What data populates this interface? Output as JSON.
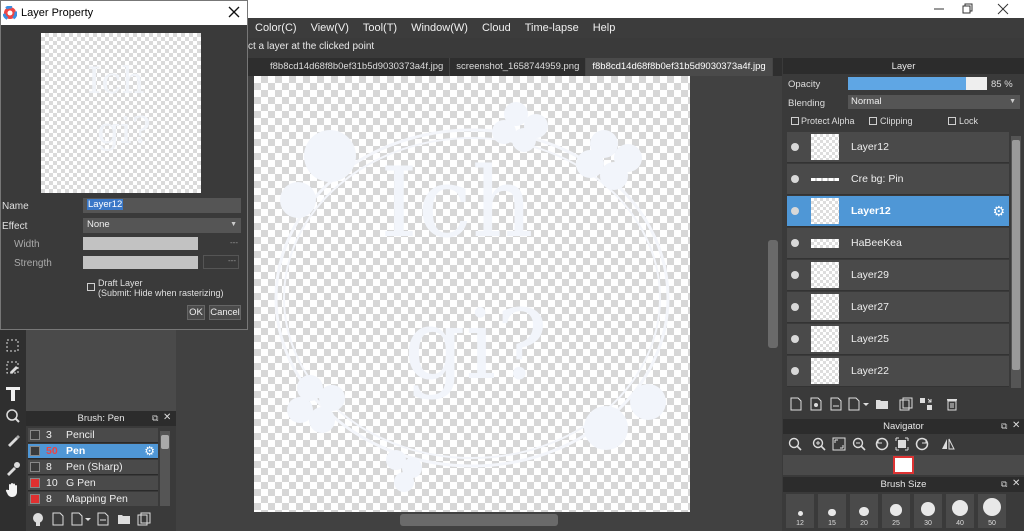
{
  "menu": [
    "Color(C)",
    "View(V)",
    "Tool(T)",
    "Window(W)",
    "Cloud",
    "Time-lapse",
    "Help"
  ],
  "hint": "ct a layer at the clicked point",
  "tabs": [
    {
      "label": "f8b8cd14d68f8b0ef31b5d9030373a4f.jpg",
      "active": false
    },
    {
      "label": "screenshot_1658744959.png",
      "active": false
    },
    {
      "label": "f8b8cd14d68f8b0ef31b5d9030373a4f.jpg",
      "active": true
    }
  ],
  "canvas": {
    "line1": "Ich",
    "line2": "gi?"
  },
  "dialog": {
    "title": "Layer Property",
    "name_label": "Name",
    "name_value": "Layer12",
    "effect_label": "Effect",
    "effect_value": "None",
    "width_label": "Width",
    "strength_label": "Strength",
    "dash1": "---",
    "dash2": "---",
    "draft_label": "Draft Layer",
    "draft_sub": "(Submit: Hide when rasterizing)",
    "ok": "OK",
    "cancel": "Cancel"
  },
  "brush": {
    "title": "Brush: Pen",
    "items": [
      {
        "size": "3",
        "name": "Pencil",
        "color": "#3a3a3a"
      },
      {
        "size": "50",
        "name": "Pen",
        "color": "#3a3a3a"
      },
      {
        "size": "8",
        "name": "Pen (Sharp)",
        "color": "#3a3a3a"
      },
      {
        "size": "10",
        "name": "G Pen",
        "color": "#e03030"
      },
      {
        "size": "8",
        "name": "Mapping Pen",
        "color": "#e03030"
      }
    ]
  },
  "layer": {
    "title": "Layer",
    "opacity_label": "Opacity",
    "opacity_value": "85 %",
    "opacity": 0.85,
    "blending_label": "Blending",
    "blending_value": "Normal",
    "protect_alpha": "Protect Alpha",
    "clipping": "Clipping",
    "lock": "Lock",
    "layers": [
      {
        "name": "Layer12",
        "thumb": "full"
      },
      {
        "name": "Cre bg: Pin",
        "thumb": "line"
      },
      {
        "name": "Layer12",
        "thumb": "full",
        "selected": true
      },
      {
        "name": "HaBeeKea",
        "thumb": "strip"
      },
      {
        "name": "Layer29",
        "thumb": "full"
      },
      {
        "name": "Layer27",
        "thumb": "full"
      },
      {
        "name": "Layer25",
        "thumb": "full"
      },
      {
        "name": "Layer22",
        "thumb": "full"
      }
    ]
  },
  "navigator": {
    "title": "Navigator"
  },
  "brush_size": {
    "title": "Brush Size",
    "sizes": [
      "12",
      "15",
      "20",
      "25",
      "30",
      "40",
      "50"
    ]
  },
  "colors": {
    "accent": "#4f97d6",
    "red": "#e03030"
  }
}
